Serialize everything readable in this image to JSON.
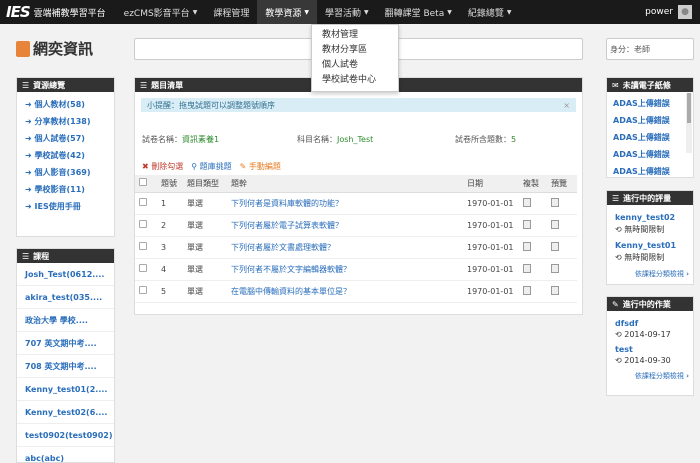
{
  "nav": {
    "logo": "IES",
    "brand": "雲端補教學習平台",
    "items": [
      {
        "label": "ezCMS影音平台",
        "caret": "▼"
      },
      {
        "label": "課程管理",
        "caret": ""
      },
      {
        "label": "教學資源",
        "caret": "▼"
      },
      {
        "label": "學習活動",
        "caret": "▼"
      },
      {
        "label": "翻轉課堂 Beta",
        "caret": "▼"
      },
      {
        "label": "紀錄總覽",
        "caret": "▼"
      }
    ],
    "user": "power"
  },
  "dropdown": [
    "教材管理",
    "教材分享區",
    "個人試卷",
    "學校試卷中心"
  ],
  "site_logo": "網奕資訊",
  "identity": "身分：老師",
  "resources": {
    "title": "資源總覽",
    "items": [
      "個人教材(58)",
      "分享教材(138)",
      "個人試卷(57)",
      "學校試卷(42)",
      "個人影音(369)",
      "學校影音(11)",
      "IES使用手冊"
    ]
  },
  "courses": {
    "title": "課程",
    "items": [
      "Josh_Test(0612....",
      "akira_test(035....",
      "政治大學 學校....",
      "707 英文期中考....",
      "708 英文期中考....",
      "Kenny_test01(2....",
      "Kenny_test02(6....",
      "test0902(test0902)",
      "abc(abc)"
    ]
  },
  "main": {
    "title": "題目清單",
    "hint": "小提醒：拖曳試題可以調整題號順序",
    "close": "×",
    "paper_label": "試卷名稱：",
    "paper_value": "資訊素養1",
    "subject_label": "科目名稱：",
    "subject_value": "Josh_Test",
    "count_label": "試卷所含題數：",
    "count_value": "5",
    "actions": {
      "delete": "刪除勾選",
      "group": "題庫挑題",
      "manual": "手動編題"
    },
    "headers": [
      "",
      "題號",
      "題目類型",
      "題幹",
      "日期",
      "複製",
      "預覽"
    ],
    "rows": [
      {
        "no": "1",
        "type": "單選",
        "stem": "下列何者是資料庫軟體的功能？",
        "date": "1970-01-01"
      },
      {
        "no": "2",
        "type": "單選",
        "stem": "下列何者屬於電子試算表軟體？",
        "date": "1970-01-01"
      },
      {
        "no": "3",
        "type": "單選",
        "stem": "下列何者屬於文書處理軟體？",
        "date": "1970-01-01"
      },
      {
        "no": "4",
        "type": "單選",
        "stem": "下列何者不屬於文字編輯器軟體？",
        "date": "1970-01-01"
      },
      {
        "no": "5",
        "type": "單選",
        "stem": "在電腦中傳輸資料的基本單位是？",
        "date": "1970-01-01"
      }
    ]
  },
  "mail": {
    "title": "未讀電子紙條",
    "items": [
      "ADAS上傳錯誤",
      "ADAS上傳錯誤",
      "ADAS上傳錯誤",
      "ADAS上傳錯誤",
      "ADAS上傳錯誤"
    ]
  },
  "evals": {
    "title": "進行中的評量",
    "items": [
      {
        "name": "kenny_test02",
        "status": "無時間限制"
      },
      {
        "name": "Kenny_test01",
        "status": "無時間限制"
      }
    ],
    "more": "依課程分類檢視"
  },
  "homework": {
    "title": "進行中的作業",
    "items": [
      {
        "name": "dfsdf",
        "date": "2014-09-17"
      },
      {
        "name": "test",
        "date": "2014-09-30"
      }
    ],
    "more": "依課程分類檢視"
  }
}
